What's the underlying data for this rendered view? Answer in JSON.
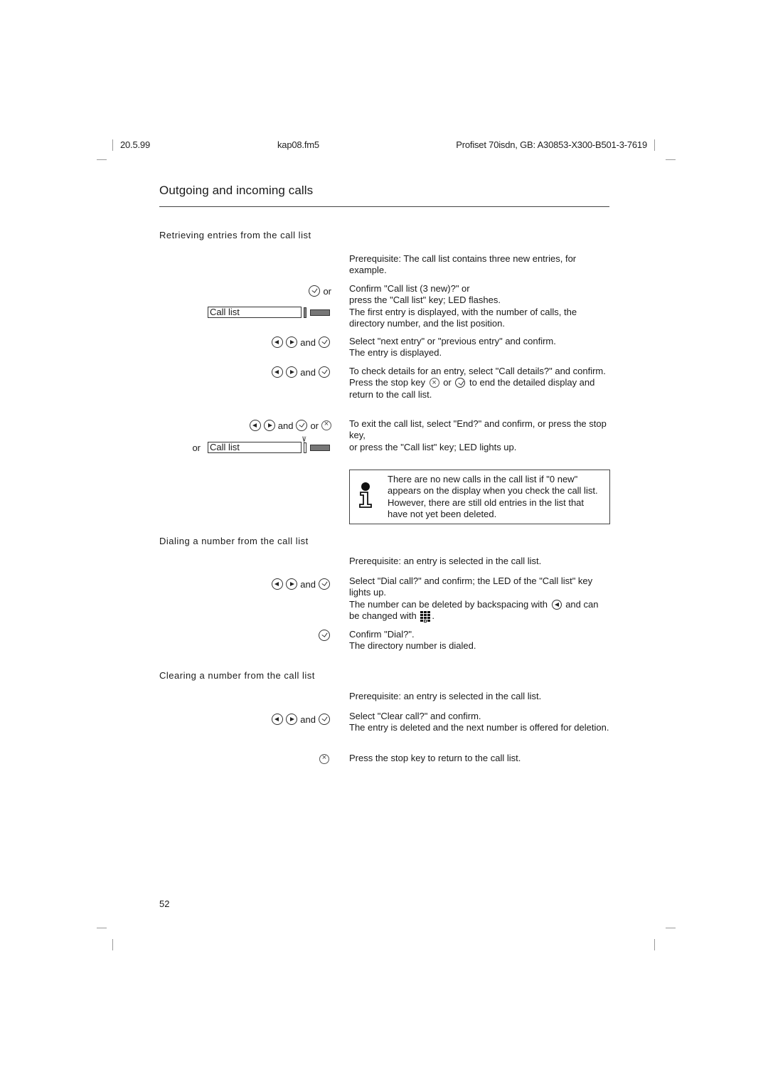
{
  "header": {
    "date": "20.5.99",
    "file": "kap08.fm5",
    "product": "Profiset 70isdn, GB: A30853-X300-B501-3-7619"
  },
  "page_title": "Outgoing and incoming calls",
  "sections": {
    "retrieving": {
      "heading": "Retrieving entries from the call list",
      "prereq": "Prerequisite: The call list contains three new entries, for example.",
      "step1_left_or": "or",
      "step1_callkey_label": "Call list",
      "step1_text_a": "Confirm \"Call list (3 new)?\" or",
      "step1_text_b": "press the \"Call list\" key; LED flashes.",
      "step1_text_c": "The first entry is displayed, with the number of calls, the directory number, and the list position.",
      "step2_left_and": "and",
      "step2_text_a": "Select \"next entry\" or \"previous entry\" and confirm.",
      "step2_text_b": "The entry is displayed.",
      "step3_left_and": "and",
      "step3_text_a": "To check details for an entry, select \"Call details?\" and confirm.",
      "step3_text_b1": "Press the stop key",
      "step3_text_b2": "or",
      "step3_text_b3": "to end the detailed display and return to the call list.",
      "step4_left_and": "and",
      "step4_left_or": "or",
      "step4_left_or2": "or",
      "step4_callkey_label": "Call list",
      "step4_text_a": "To exit the call list, select \"End?\" and confirm, or press the stop key,",
      "step4_text_b": "or press the \"Call list\" key; LED lights up.",
      "info_note": "There are no new calls in the call list if \"0 new\" appears on the display when you check the call list. However, there are still old entries in the list that have not yet been deleted."
    },
    "dialing": {
      "heading": "Dialing a number from the call list",
      "prereq": "Prerequisite: an entry is selected in the call list.",
      "step1_left_and": "and",
      "step1_text_a": "Select \"Dial call?\" and confirm; the LED of the \"Call list\" key lights up.",
      "step1_text_b1": "The number can be deleted by backspacing with",
      "step1_text_b2": "and can be changed with",
      "step1_text_b3": ".",
      "step2_text_a": "Confirm \"Dial?\".",
      "step2_text_b": "The directory number is dialed."
    },
    "clearing": {
      "heading": "Clearing a number from the call list",
      "prereq": "Prerequisite: an entry is selected in the call list.",
      "step1_left_and": "and",
      "step1_text_a": "Select \"Clear call?\" and confirm.",
      "step1_text_b": "The entry is deleted and the next number is offered for deletion.",
      "step2_text": "Press the stop key to return to the call list."
    }
  },
  "page_number": "52"
}
